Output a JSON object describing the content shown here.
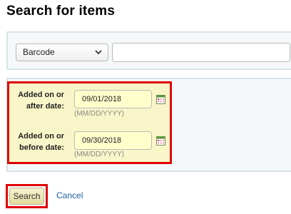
{
  "page": {
    "title": "Search for items"
  },
  "search_field": {
    "select_label": "Barcode",
    "chevron_icon": "chevron-down-icon",
    "query_value": ""
  },
  "dates": {
    "added_after": {
      "label_line1": "Added on or",
      "label_line2": "after date:",
      "value": "09/01/2018",
      "hint": "(MM/DD/YYYY)",
      "icon": "calendar-icon"
    },
    "added_before": {
      "label_line1": "Added on or",
      "label_line2": "before date:",
      "value": "09/30/2018",
      "hint": "(MM/DD/YYYY)",
      "icon": "calendar-icon"
    }
  },
  "actions": {
    "search_label": "Search",
    "cancel_label": "Cancel"
  },
  "colors": {
    "highlight_border": "#e00000",
    "date_panel_bg": "#f8f6c8",
    "date_input_bg": "#ffffcc",
    "link": "#1a5f9e"
  }
}
